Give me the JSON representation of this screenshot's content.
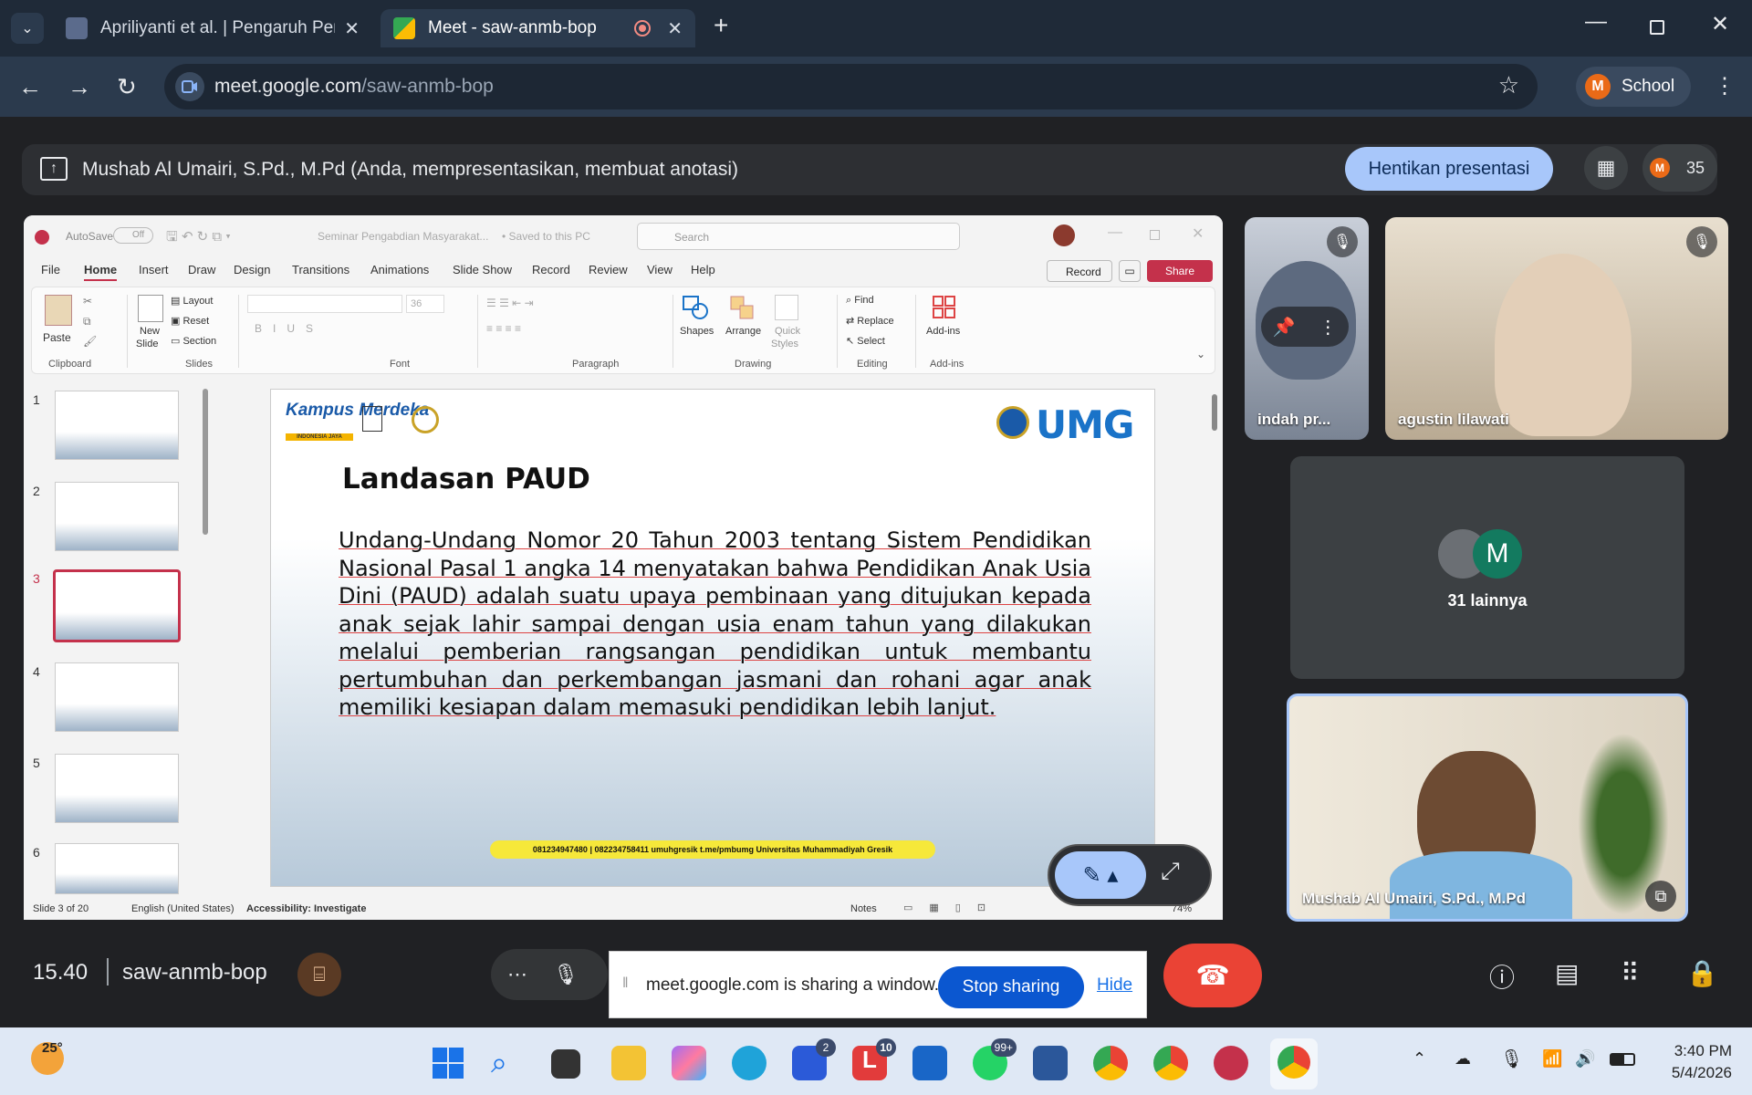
{
  "browser": {
    "tabs": [
      {
        "title": "Apriliyanti et al. | Pengaruh Pem",
        "active": false
      },
      {
        "title": "Meet - saw-anmb-bop",
        "active": true
      }
    ],
    "url_host": "meet.google.com",
    "url_path": "/saw-anmb-bop",
    "profile_initial": "M",
    "profile_label": "School"
  },
  "presentation_bar": {
    "text": "Mushab Al Umairi, S.Pd., M.Pd (Anda, mempresentasikan, membuat anotasi)",
    "stop_label": "Hentikan presentasi",
    "participant_count": "35"
  },
  "ppt": {
    "autosave": "AutoSave",
    "autosave_state": "Off",
    "doc_title": "Seminar Pengabdian Masyarakat...",
    "saved": "• Saved to this PC",
    "search": "Search",
    "record_btn": "Record",
    "share_btn": "Share",
    "tabs": [
      "File",
      "Home",
      "Insert",
      "Draw",
      "Design",
      "Transitions",
      "Animations",
      "Slide Show",
      "Record",
      "Review",
      "View",
      "Help"
    ],
    "ribbon": {
      "paste": "Paste",
      "clipboard": "Clipboard",
      "new_slide": "New",
      "new_slide2": "Slide",
      "layout": "Layout",
      "reset": "Reset",
      "section": "Section",
      "slides": "Slides",
      "font_size": "36",
      "font": "Font",
      "paragraph": "Paragraph",
      "shapes": "Shapes",
      "arrange": "Arrange",
      "quick1": "Quick",
      "quick2": "Styles",
      "drawing": "Drawing",
      "find": "Find",
      "replace": "Replace",
      "select": "Select",
      "editing": "Editing",
      "addins": "Add-ins",
      "addins_group": "Add-ins"
    },
    "slide_numbers": [
      "1",
      "2",
      "3",
      "4",
      "5",
      "6"
    ],
    "slide": {
      "logo_left": "Kampus Merdeka",
      "logo_left_sub": "INDONESIA JAYA",
      "logo_right": "UMG",
      "title": "Landasan PAUD",
      "body": "Undang-Undang Nomor 20 Tahun 2003 tentang Sistem Pendidikan Nasional Pasal 1 angka 14 menyatakan bahwa Pendidikan Anak Usia Dini (PAUD) adalah suatu upaya pembinaan yang ditujukan kepada anak sejak lahir sampai dengan usia enam tahun yang dilakukan melalui pemberian rangsangan pendidikan untuk membantu pertumbuhan dan perkembangan jasmani dan rohani agar anak memiliki kesiapan dalam memasuki pendidikan lebih lanjut.",
      "footer": "081234947480 | 082234758411   umuhgresik   t.me/pmbumg   Universitas Muhammadiyah Gresik"
    },
    "status": {
      "slide_of": "Slide 3 of 20",
      "language": "English (United States)",
      "accessibility": "Accessibility: Investigate",
      "notes": "Notes",
      "zoom": "74%"
    }
  },
  "tiles": [
    {
      "name": "indah pr..."
    },
    {
      "name": "agustin lilawati"
    },
    {
      "name": "31 lainnya",
      "avatar": "M"
    },
    {
      "name": "Mushab Al Umairi, S.Pd., M.Pd"
    }
  ],
  "bottom": {
    "time": "15.40",
    "meeting_code": "saw-anmb-bop",
    "share_notice": "meet.google.com is sharing a window.",
    "stop_sharing": "Stop sharing",
    "hide": "Hide"
  },
  "taskbar": {
    "weather": "25°",
    "badges": {
      "app_store": "2",
      "lark": "10",
      "whatsapp": "99+"
    },
    "clock_time": "3:40 PM",
    "clock_date": "5/4/2026"
  },
  "colors": {
    "accent_blue": "#a8c7fa",
    "end_call": "#ea4335",
    "ppt_red": "#c4314b",
    "umg_blue": "#1a73c8",
    "footer_yellow": "#f6e83a"
  }
}
